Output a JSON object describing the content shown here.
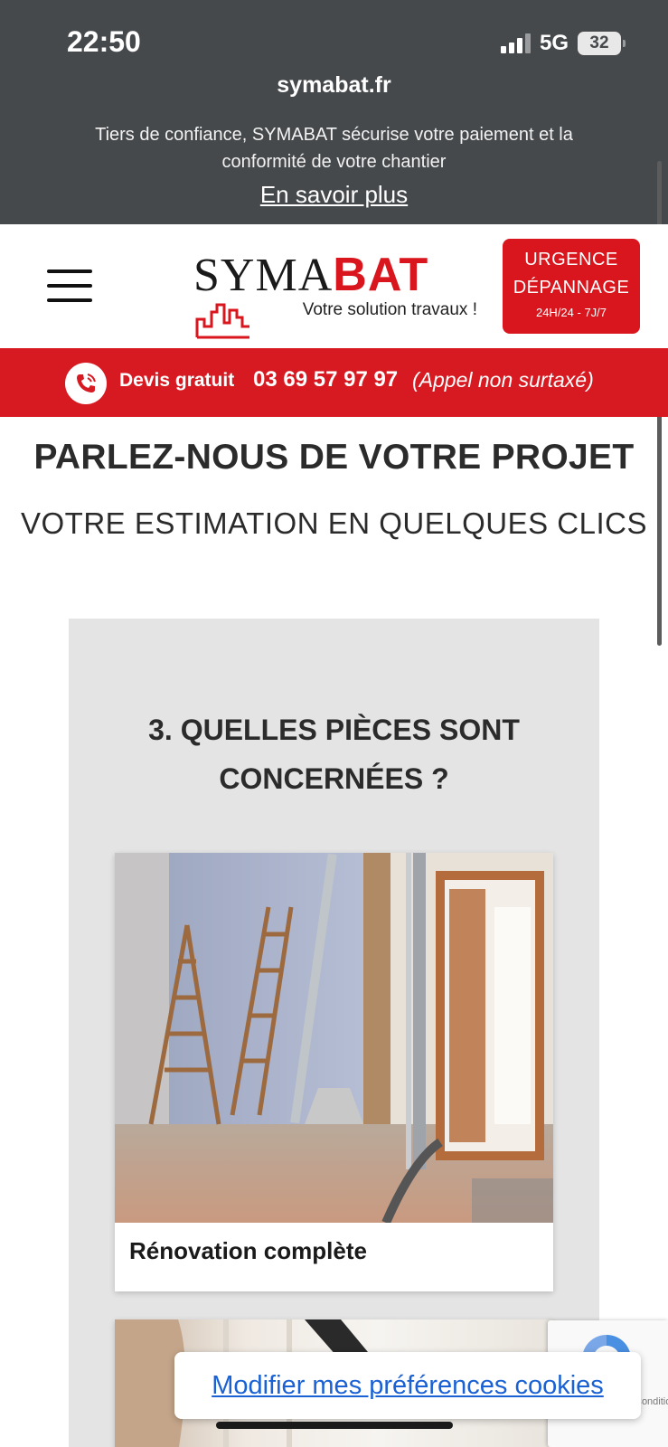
{
  "status_bar": {
    "time": "22:50",
    "network": "5G",
    "battery": "32"
  },
  "browser": {
    "url": "symabat.fr"
  },
  "banner": {
    "trust_text": "Tiers de confiance, SYMABAT sécurise votre paiement et la conformité de votre chantier",
    "learn_more": "En savoir plus"
  },
  "header": {
    "logo_part1": "SYMA",
    "logo_part2": "BAT",
    "tagline": "Votre solution travaux !",
    "urgence_line1": "URGENCE",
    "urgence_line2": "DÉPANNAGE",
    "urgence_line3": "24H/24 - 7J/7"
  },
  "phone_bar": {
    "devis": "Devis gratuit",
    "number": "03 69 57 97 97",
    "note": "(Appel non surtaxé)"
  },
  "page": {
    "title": "PARLEZ-NOUS DE VOTRE PROJET",
    "subtitle": "VOTRE ESTIMATION EN QUELQUES CLICS"
  },
  "step": {
    "question": "3. QUELLES PIÈCES SONT CONCERNÉES ?",
    "options": [
      {
        "label": "Rénovation complète"
      }
    ]
  },
  "cookie_button": "Modifier mes préférences cookies",
  "recaptcha_text": "Conditions",
  "colors": {
    "brand_red": "#d71a21",
    "dark_banner": "#46494c",
    "link_blue": "#1a61d4"
  }
}
